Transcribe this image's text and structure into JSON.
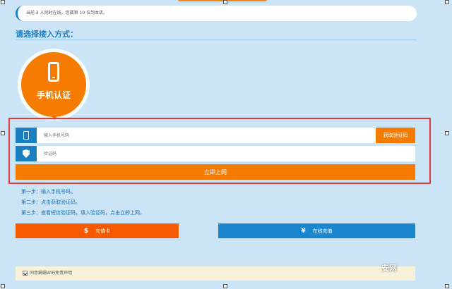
{
  "notice": "当前 3 人同时在线，您属第 10 位到本店。",
  "section_title": "请选择接入方式：",
  "auth_bubble": {
    "label": "手机认证",
    "icon": "phone-icon"
  },
  "form": {
    "phone_placeholder": "输入手机号码",
    "code_placeholder": "验证码",
    "get_code_label": "获取验证码",
    "submit_label": "立即上网"
  },
  "steps": [
    "第一步：输入手机号码。",
    "第二步：点击获取验证码。",
    "第三步：查看短信验证码，填入验证码，点击立即上网。"
  ],
  "actions": {
    "recharge_card": {
      "icon": "$",
      "label": "充值卡"
    },
    "online_recharge": {
      "icon": "¥",
      "label": "在线充值"
    }
  },
  "agreement": "同意蜗蜗WiFi免责声明",
  "watermark": "安网",
  "colors": {
    "accent_orange": "#f57c00",
    "accent_blue": "#1a7fc1",
    "outline_red": "#e03a3a"
  }
}
